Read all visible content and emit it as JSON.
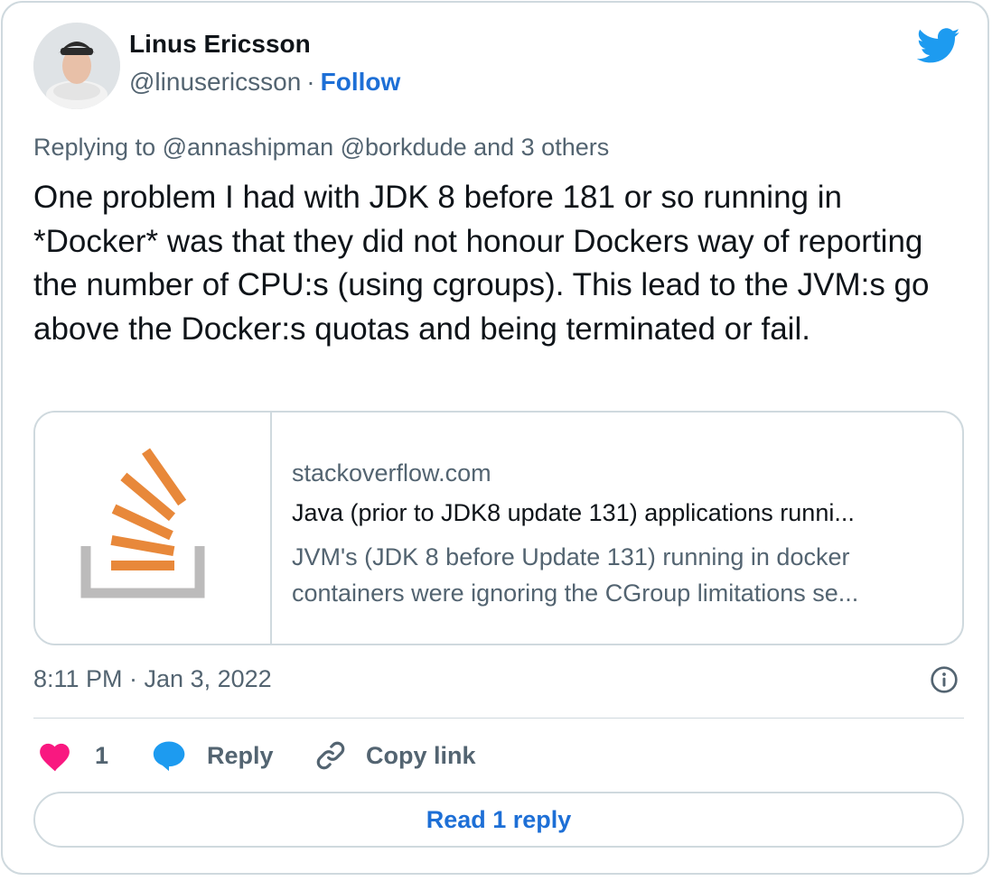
{
  "author": {
    "name": "Linus Ericsson",
    "handle": "@linusericsson",
    "separator": "·",
    "follow_label": "Follow"
  },
  "replying_to": "Replying to @annashipman @borkdude and 3 others",
  "tweet_text": "One problem I had with JDK 8 before 181 or so running in *Docker* was that they did not honour Dockers way of reporting the number of CPU:s (using cgroups). This lead to the JVM:s go above the Docker:s quotas and being terminated or fail.",
  "link_card": {
    "domain": "stackoverflow.com",
    "title": "Java (prior to JDK8 update 131) applications runni...",
    "description_line1": "JVM's (JDK 8 before Update 131) running in docker",
    "description_line2": "containers were ignoring the CGroup limitations se...",
    "thumbnail_icon": "stackoverflow-logo-icon"
  },
  "timestamp": "8:11 PM · Jan 3, 2022",
  "actions": {
    "like_count": "1",
    "reply_label": "Reply",
    "copy_link_label": "Copy link"
  },
  "read_replies_label": "Read 1 reply",
  "colors": {
    "accent": "#1d6fd6",
    "like": "#f91880",
    "twitter_blue": "#1d9bf0",
    "so_orange": "#e8883a",
    "so_gray": "#bcbbbb"
  }
}
